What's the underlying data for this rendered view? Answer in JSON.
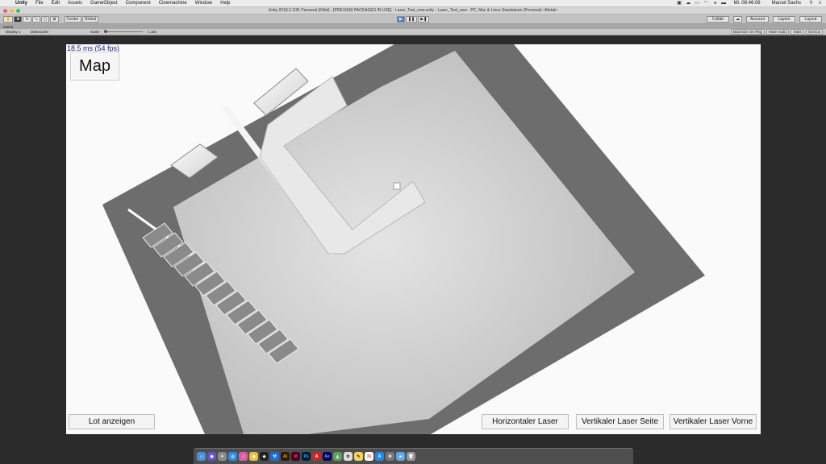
{
  "menubar": {
    "items": [
      "Unity",
      "File",
      "Edit",
      "Assets",
      "GameObject",
      "Component",
      "Cinemachine",
      "Window",
      "Help"
    ],
    "clock": "Mi. 08:46:06",
    "user": "Marcel Sachs"
  },
  "window": {
    "title": "Unity 2018.2.10f1 Personal (64bit) - [PREVIEW PACKAGES IN USE] - Laser_Test_new.unity - Laser_Test_new - PC, Mac & Linux Standalone (Personal) <Metal>"
  },
  "toolbar": {
    "center_label": "Center",
    "global_label": "Global",
    "collab_label": "Collab",
    "account_label": "Account",
    "layers_label": "Layers",
    "layout_label": "Layout"
  },
  "game_view": {
    "tab_label": "Game",
    "display": "Display 1",
    "resolution": "2560x1440",
    "scale_label": "Scale",
    "scale_value": "1.18x",
    "maximize_on_play": "Maximize On Play",
    "mute_audio": "Mute Audio",
    "stats": "Stats",
    "gizmos": "Gizmos"
  },
  "hud": {
    "fps_text": "18.5 ms (54 fps)",
    "map_button": "Map",
    "lot_button": "Lot anzeigen",
    "horizontal_button": "Horizontaler Laser",
    "vertical_side_button": "Vertikaler Laser Seite",
    "vertical_front_button": "Vertikaler Laser Vorne"
  },
  "colors": {
    "floor": "#cfcfcf",
    "walls": "#6b6b6b",
    "background": "#fafafa"
  },
  "dock_icons": [
    "finder-icon",
    "siri-icon",
    "launchpad-icon",
    "safari-icon",
    "itunes-icon",
    "chrome-icon",
    "unity-icon",
    "xcode-icon",
    "illustrator-icon",
    "indesign-icon",
    "photoshop-icon",
    "acrobat-icon",
    "aftereffects-icon",
    "maps-icon",
    "photos-icon",
    "notes-icon",
    "calendar-icon",
    "appstore-icon",
    "preferences-icon",
    "folder-icon",
    "trash-icon"
  ]
}
